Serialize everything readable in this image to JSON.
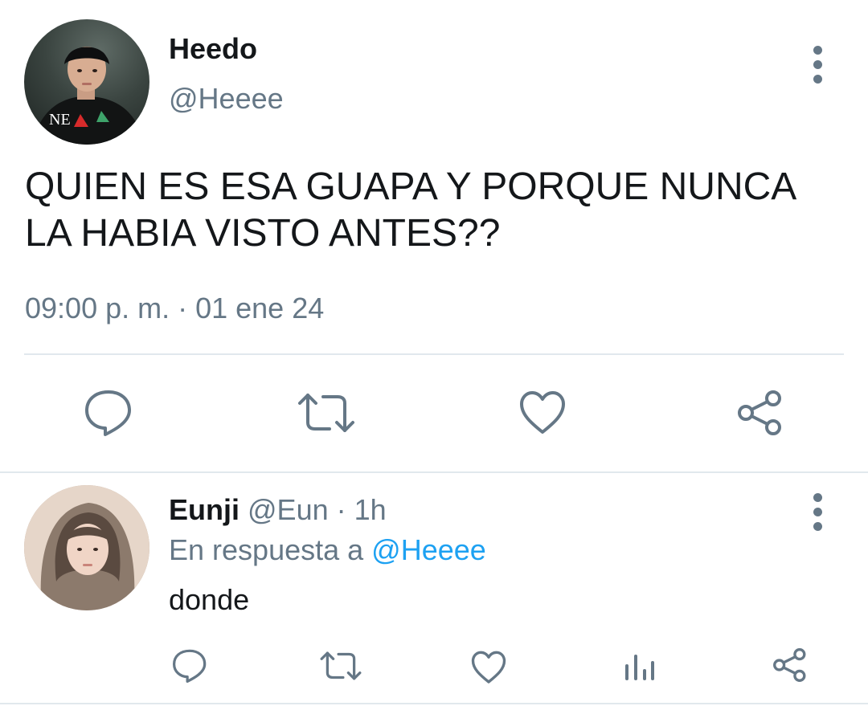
{
  "main_tweet": {
    "display_name": "Heedo",
    "handle": "@Heeee",
    "text": "QUIEN ES ESA GUAPA Y PORQUE NUNCA LA HABIA VISTO ANTES??",
    "timestamp": "09:00 p. m. · 01 ene 24",
    "avatar_text": "NE",
    "actions": [
      "reply-icon",
      "retweet-icon",
      "like-icon",
      "share-icon"
    ]
  },
  "reply": {
    "display_name": "Eunji",
    "handle": "@Eun",
    "separator": "·",
    "time": "1h",
    "replying_prefix": "En respuesta a",
    "replying_to": "@Heeee",
    "text": "donde",
    "actions": [
      "reply-icon",
      "retweet-icon",
      "like-icon",
      "analytics-icon",
      "share-icon"
    ]
  },
  "colors": {
    "text_primary": "#14171a",
    "text_secondary": "#657786",
    "mention": "#1da1f2",
    "divider": "#e1e8ed"
  }
}
